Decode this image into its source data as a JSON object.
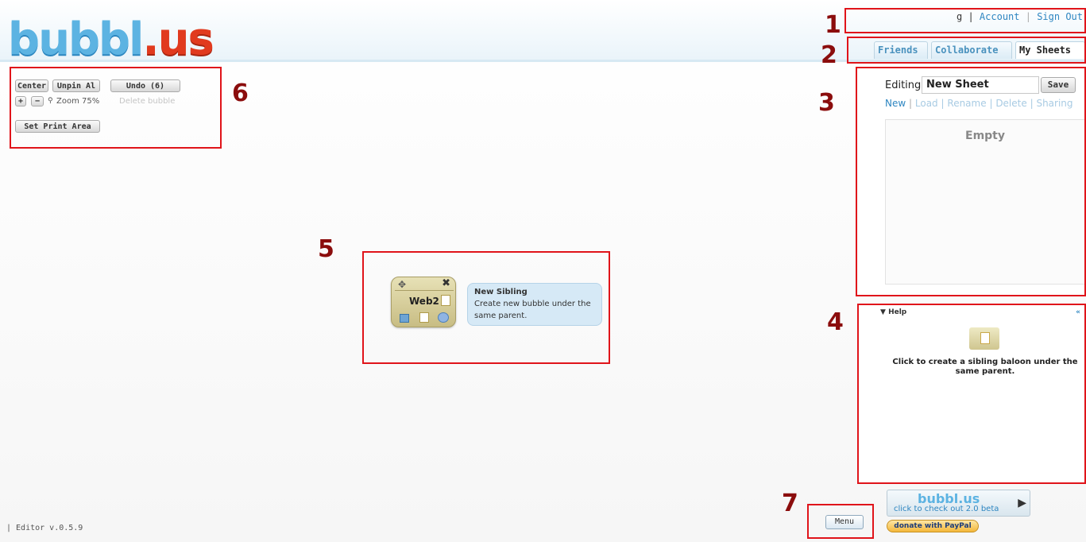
{
  "app": {
    "logo_part1": "bubbl",
    "logo_dot": ".",
    "logo_part2": "us"
  },
  "top_nav": {
    "user": "g",
    "sep1": "|",
    "account": "Account",
    "sep2": "|",
    "sign_out": "Sign Out"
  },
  "tabs": [
    {
      "label": "Friends"
    },
    {
      "label": "Collaborate"
    },
    {
      "label": "My Sheets"
    }
  ],
  "sheets_panel": {
    "editing_label": "Editing",
    "sheet_name": "New Sheet",
    "save_label": "Save",
    "actions": [
      "New",
      "Load",
      "Rename",
      "Delete",
      "Sharing"
    ],
    "list_empty": "Empty"
  },
  "help_panel": {
    "title": "Help",
    "collapse": "«",
    "text": "Click to create a sibling baloon under the same parent."
  },
  "toolbar": {
    "center": "Center",
    "unpin_all": "Unpin Al",
    "undo": "Undo (6)",
    "zoom_in": "+",
    "zoom_out": "−",
    "zoom_label": "Zoom 75%",
    "delete_bubble": "Delete bubble",
    "set_print_area": "Set Print Area"
  },
  "bubble": {
    "text": "Web2",
    "tooltip_title": "New Sibling",
    "tooltip_body": "Create new bubble under the same parent."
  },
  "footer": {
    "version": "| Editor v.0.5.9",
    "menu": "Menu"
  },
  "promo": {
    "logo": "bubbl.us",
    "tagline": "click to check out 2.0 beta",
    "donate": "donate with PayPal"
  },
  "annotations": [
    "1",
    "2",
    "3",
    "4",
    "5",
    "6",
    "7"
  ],
  "colors": {
    "annotation_box": "#e0141a",
    "annotation_number": "#8b0d0d",
    "link": "#2e86c1",
    "bubble": "#d8cf9c"
  }
}
